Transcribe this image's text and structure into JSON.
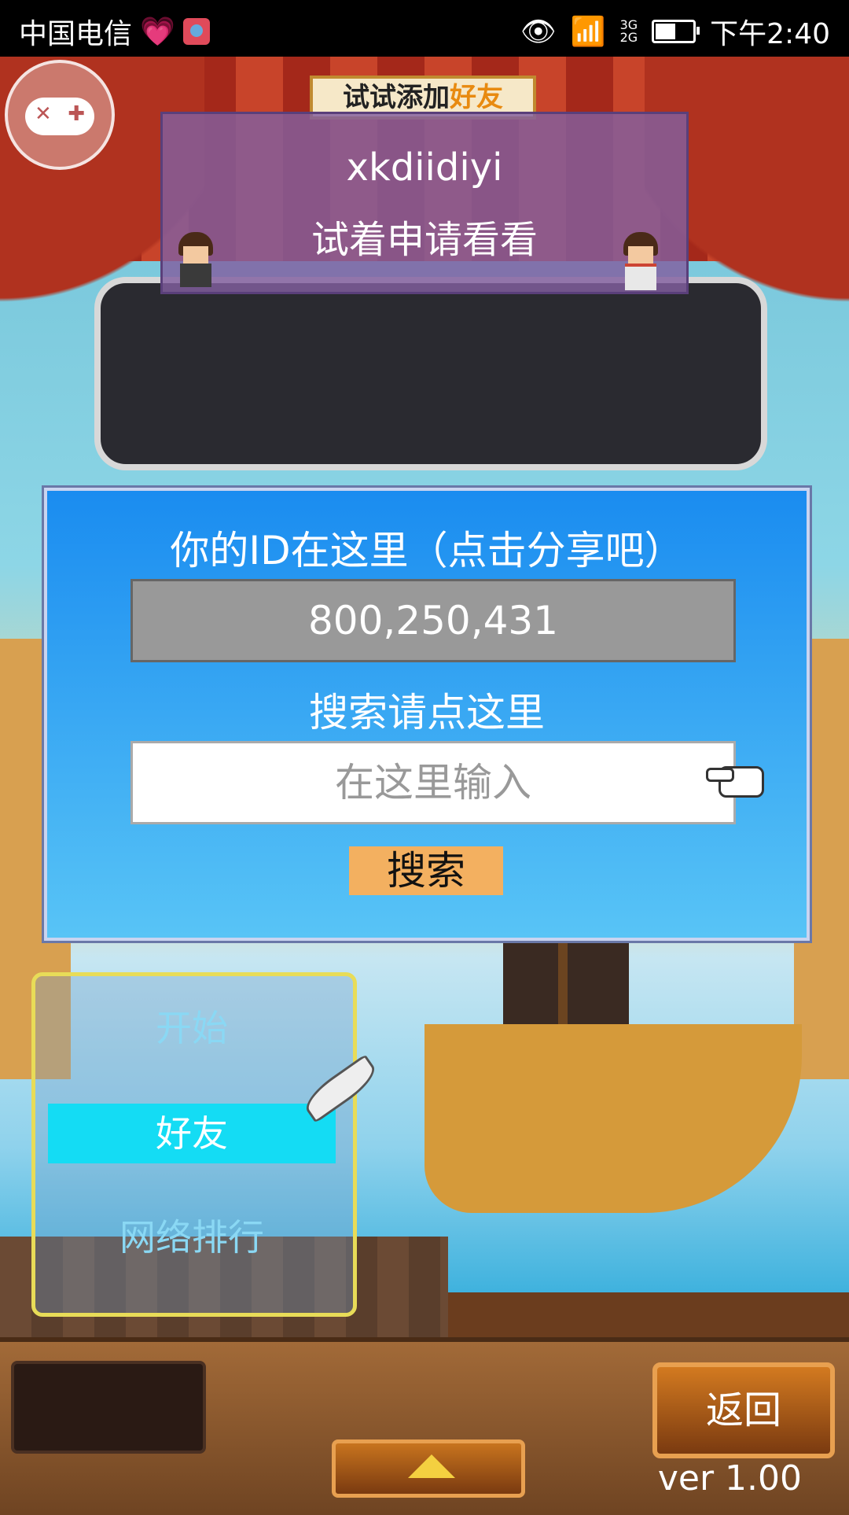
{
  "status_bar": {
    "carrier": "中国电信",
    "network": [
      "3G",
      "2G"
    ],
    "time": "下午2:40",
    "battery_level": 0.55
  },
  "friend_suggestion": {
    "tag_prefix": "试试添加",
    "tag_highlight": "好友",
    "name": "xkdiidiyi",
    "hint": "试着申请看看"
  },
  "id_dialog": {
    "title": "你的ID在这里（点击分享吧）",
    "id_value": "800,250,431",
    "search_title": "搜索请点这里",
    "search_placeholder": "在这里输入",
    "search_button": "搜索"
  },
  "menu": {
    "items": [
      {
        "label": "开始",
        "selected": false
      },
      {
        "label": "好友",
        "selected": true
      },
      {
        "label": "网络排行",
        "selected": false
      }
    ]
  },
  "bottom": {
    "back_button": "返回",
    "version": "ver 1.00"
  },
  "colors": {
    "dialog_top": "#1a8cf0",
    "dialog_bottom": "#58c4f6",
    "menu_selected": "#14dcf4",
    "search_button": "#f3b060"
  }
}
